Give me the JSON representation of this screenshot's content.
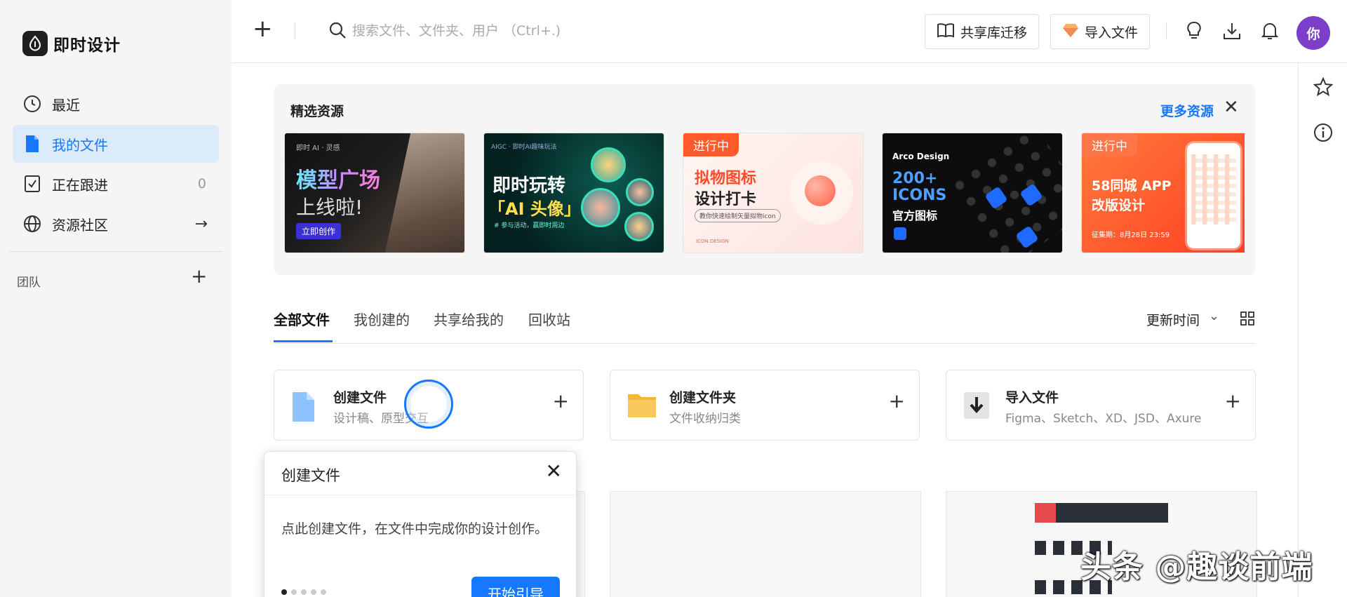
{
  "brand": {
    "name": "即时设计"
  },
  "sidebar": {
    "items": [
      {
        "label": "最近",
        "icon": "clock-icon"
      },
      {
        "label": "我的文件",
        "icon": "file-icon",
        "active": true
      },
      {
        "label": "正在跟进",
        "icon": "bookmark-icon",
        "count": "0"
      },
      {
        "label": "资源社区",
        "icon": "globe-icon"
      }
    ],
    "team_label": "团队"
  },
  "topbar": {
    "search_placeholder": "搜索文件、文件夹、用户 （Ctrl+.)",
    "migrate_label": "共享库迁移",
    "import_label": "导入文件",
    "avatar_text": "你"
  },
  "featured": {
    "title": "精选资源",
    "more_label": "更多资源",
    "cards": [
      {
        "tagline": "即时 AI · 灵感",
        "title1": "模型广场",
        "title2": "上线啦!",
        "cta": "立即创作"
      },
      {
        "tagline": "AIGC · 即时AI趣味玩法",
        "title1": "即时玩转",
        "title2": "「AI 头像」",
        "note": "# 参与活动，赢即时周边"
      },
      {
        "tag": "进行中",
        "title1": "拟物图标",
        "title2": "设计打卡",
        "note": "教你快速绘制矢量拟物icon",
        "footer": "ICON DESIGN"
      },
      {
        "brand": "Arco Design",
        "title1": "200+",
        "title2": "ICONS",
        "title3": "官方图标"
      },
      {
        "tag": "进行中",
        "title1": "58同城 APP",
        "title2": "改版设计",
        "note": "征集期：8月28日 23:59"
      }
    ]
  },
  "tabs": {
    "items": [
      "全部文件",
      "我创建的",
      "共享给我的",
      "回收站"
    ],
    "sort_label": "更新时间"
  },
  "actions": [
    {
      "title": "创建文件",
      "subtitle": "设计稿、原型交互",
      "icon": "file-icon"
    },
    {
      "title": "创建文件夹",
      "subtitle": "文件收纳归类",
      "icon": "folder-icon"
    },
    {
      "title": "导入文件",
      "subtitle": "Figma、Sketch、XD、JSD、Axure",
      "icon": "download-icon"
    }
  ],
  "popover": {
    "title": "创建文件",
    "body": "点此创建文件，在文件中完成你的设计创作。",
    "button": "开始引导",
    "step": 1,
    "total": 5
  },
  "watermark": "头条 @趣谈前端",
  "colors": {
    "accent": "#1677ff",
    "avatar": "#7b3fc9",
    "tag": "#ff5a2c"
  }
}
